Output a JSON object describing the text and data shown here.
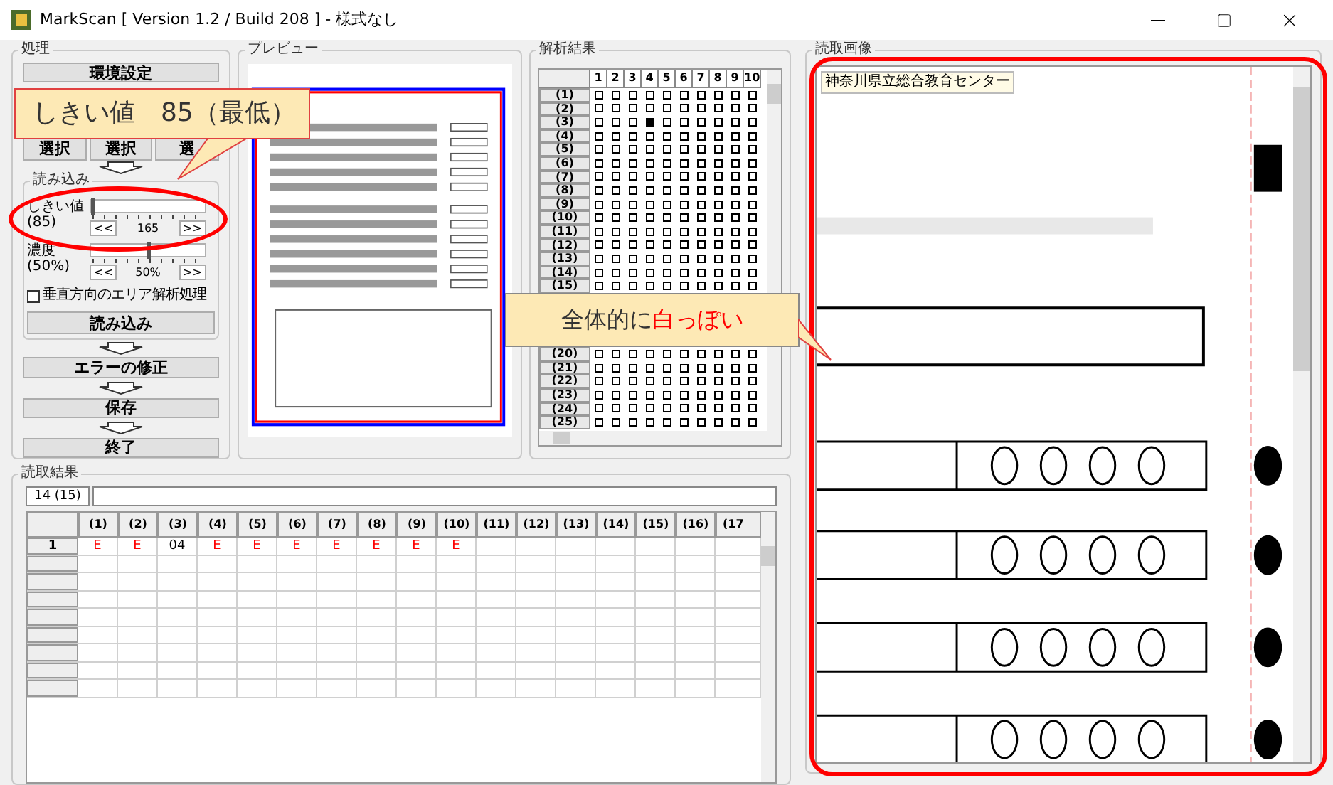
{
  "window": {
    "title": "MarkScan [ Version 1.2 / Build 208 ] - 様式なし"
  },
  "process": {
    "title": "処理",
    "settings_button": "環境設定",
    "select_buttons": [
      "選択",
      "選択",
      "選"
    ],
    "read_group": {
      "title": "読み込み",
      "sliders": [
        {
          "label": "しきい値",
          "reading": "(85)",
          "level": 0,
          "scale_label": "165",
          "min_button": "<<",
          "max_button": ">>"
        },
        {
          "label": "濃度",
          "reading": "(50%)",
          "level": 0.5,
          "scale_label": "50%",
          "min_button": "<<",
          "max_button": ">>"
        }
      ],
      "checkbox": {
        "label": "垂直方向のエリア解析処理",
        "checked": false
      },
      "read_button": "読み込み"
    },
    "fix_button": "エラーの修正",
    "save_button": "保存",
    "exit_button": "終了"
  },
  "preview": {
    "title": "プレビュー"
  },
  "analysis": {
    "title": "解析結果",
    "columns": [
      "1",
      "2",
      "3",
      "4",
      "5",
      "6",
      "7",
      "8",
      "9",
      "10"
    ],
    "rows": [
      {
        "label": "(1)",
        "marks": [
          false,
          false,
          false,
          false,
          false,
          false,
          false,
          false,
          false,
          false
        ]
      },
      {
        "label": "(2)",
        "marks": [
          false,
          false,
          false,
          false,
          false,
          false,
          false,
          false,
          false,
          false
        ]
      },
      {
        "label": "(3)",
        "marks": [
          false,
          false,
          false,
          true,
          false,
          false,
          false,
          false,
          false,
          false
        ]
      },
      {
        "label": "(4)",
        "marks": [
          false,
          false,
          false,
          false,
          false,
          false,
          false,
          false,
          false,
          false
        ]
      },
      {
        "label": "(5)",
        "marks": [
          false,
          false,
          false,
          false,
          false,
          false,
          false,
          false,
          false,
          false
        ]
      },
      {
        "label": "(6)",
        "marks": [
          false,
          false,
          false,
          false,
          false,
          false,
          false,
          false,
          false,
          false
        ]
      },
      {
        "label": "(7)",
        "marks": [
          false,
          false,
          false,
          false,
          false,
          false,
          false,
          false,
          false,
          false
        ]
      },
      {
        "label": "(8)",
        "marks": [
          false,
          false,
          false,
          false,
          false,
          false,
          false,
          false,
          false,
          false
        ]
      },
      {
        "label": "(9)",
        "marks": [
          false,
          false,
          false,
          false,
          false,
          false,
          false,
          false,
          false,
          false
        ]
      },
      {
        "label": "(10)",
        "marks": [
          false,
          false,
          false,
          false,
          false,
          false,
          false,
          false,
          false,
          false
        ]
      },
      {
        "label": "(11)",
        "marks": [
          false,
          false,
          false,
          false,
          false,
          false,
          false,
          false,
          false,
          false
        ]
      },
      {
        "label": "(12)",
        "marks": [
          false,
          false,
          false,
          false,
          false,
          false,
          false,
          false,
          false,
          false
        ]
      },
      {
        "label": "(13)",
        "marks": [
          false,
          false,
          false,
          false,
          false,
          false,
          false,
          false,
          false,
          false
        ]
      },
      {
        "label": "(14)",
        "marks": [
          false,
          false,
          false,
          false,
          false,
          false,
          false,
          false,
          false,
          false
        ]
      },
      {
        "label": "(15)",
        "marks": [
          false,
          false,
          false,
          false,
          false,
          false,
          false,
          false,
          false,
          false
        ]
      }
    ],
    "rows_below_callout": [
      {
        "label": "(20)",
        "marks": [
          false,
          false,
          false,
          false,
          false,
          false,
          false,
          false,
          false,
          false
        ]
      },
      {
        "label": "(21)",
        "marks": [
          false,
          false,
          false,
          false,
          false,
          false,
          false,
          false,
          false,
          false
        ]
      },
      {
        "label": "(22)",
        "marks": [
          false,
          false,
          false,
          false,
          false,
          false,
          false,
          false,
          false,
          false
        ]
      },
      {
        "label": "(23)",
        "marks": [
          false,
          false,
          false,
          false,
          false,
          false,
          false,
          false,
          false,
          false
        ]
      },
      {
        "label": "(24)",
        "marks": [
          false,
          false,
          false,
          false,
          false,
          false,
          false,
          false,
          false,
          false
        ]
      },
      {
        "label": "(25)",
        "marks": [
          false,
          false,
          false,
          false,
          false,
          false,
          false,
          false,
          false,
          false
        ]
      }
    ]
  },
  "results": {
    "title": "読取結果",
    "count": "14 (15)",
    "columns": [
      "(1)",
      "(2)",
      "(3)",
      "(4)",
      "(5)",
      "(6)",
      "(7)",
      "(8)",
      "(9)",
      "(10)",
      "(11)",
      "(12)",
      "(13)",
      "(14)",
      "(15)",
      "(16)",
      "(17"
    ],
    "rows": [
      {
        "label": "1",
        "cells": [
          {
            "value": "E",
            "error": true
          },
          {
            "value": "E",
            "error": true
          },
          {
            "value": "04",
            "error": false
          },
          {
            "value": "E",
            "error": true
          },
          {
            "value": "E",
            "error": true
          },
          {
            "value": "E",
            "error": true
          },
          {
            "value": "E",
            "error": true
          },
          {
            "value": "E",
            "error": true
          },
          {
            "value": "E",
            "error": true
          },
          {
            "value": "E",
            "error": true
          }
        ]
      }
    ]
  },
  "image_view": {
    "title": "読取画像",
    "tooltip": "神奈川県立総合教育センター"
  },
  "annotations": [
    {
      "kind": "callout",
      "text": "しきい値　85（最低）"
    },
    {
      "kind": "callout",
      "text": "全体的に",
      "highlight": "白っぽい"
    }
  ]
}
